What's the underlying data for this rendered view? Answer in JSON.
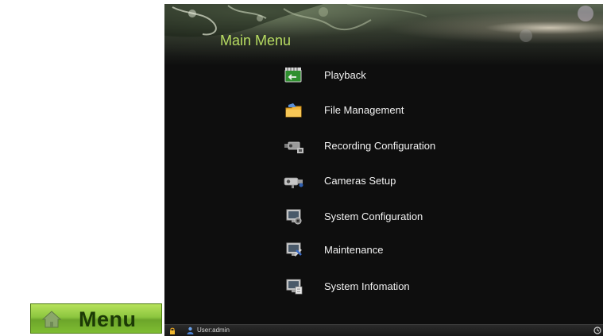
{
  "menu_button": {
    "label": "Menu",
    "icon": "home-icon",
    "colors": {
      "fill": "#8cc63f",
      "text": "#1c3a06"
    }
  },
  "window": {
    "title": "Main Menu",
    "title_color": "#b8dd62",
    "background": "#0e0e0e"
  },
  "menu_items": [
    {
      "label": "Playback",
      "icon": "playback-icon"
    },
    {
      "label": "File Management",
      "icon": "folder-icon"
    },
    {
      "label": "Recording Configuration",
      "icon": "recording-camera-icon"
    },
    {
      "label": "Cameras Setup",
      "icon": "camera-icon"
    },
    {
      "label": "System Configuration",
      "icon": "system-config-icon"
    },
    {
      "label": "Maintenance",
      "icon": "maintenance-icon"
    },
    {
      "label": "System Infomation",
      "icon": "system-info-icon"
    }
  ],
  "status_bar": {
    "user_text": "User:admin",
    "icons": [
      "lock-icon",
      "user-icon",
      "clock-icon"
    ]
  }
}
